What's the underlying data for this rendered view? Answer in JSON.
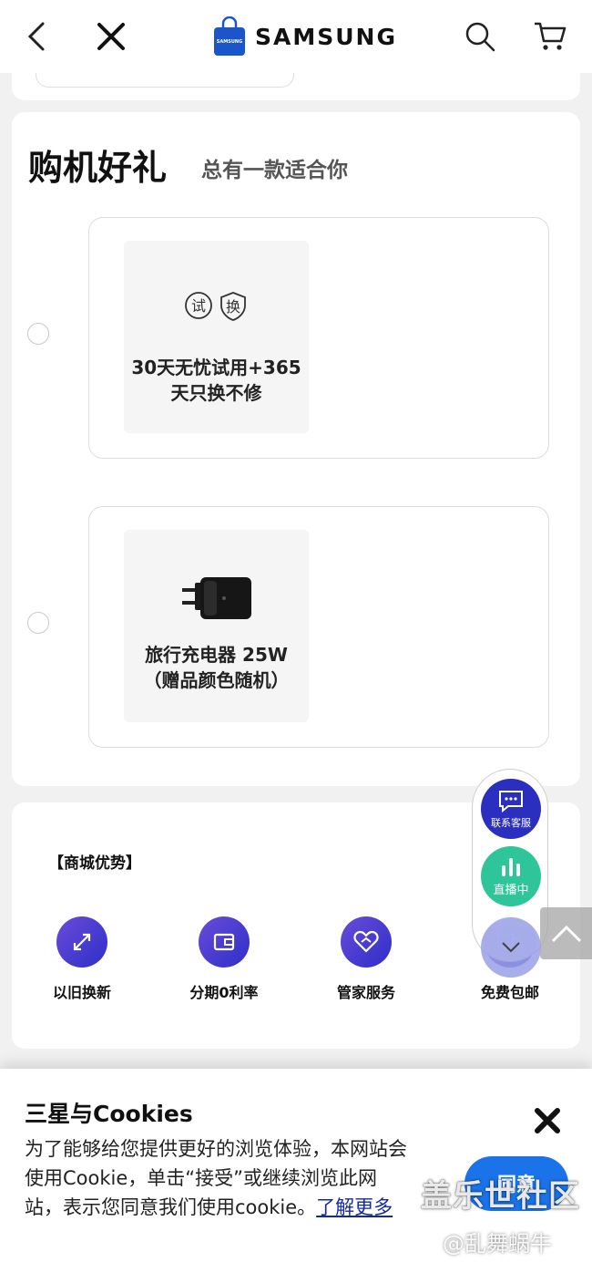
{
  "header": {
    "brand": "SAMSUNG",
    "bag_logo_text": "SAMSUNG"
  },
  "gifts": {
    "title": "购机好礼",
    "subtitle": "总有一款适合你",
    "options": [
      {
        "tag_left": "试",
        "tag_right": "换",
        "line1": "30天无忧试用+365",
        "line2": "天只换不修"
      },
      {
        "line1": "旅行充电器 25W",
        "line2": "（赠品颜色随机）"
      }
    ]
  },
  "advantages": {
    "title": "【商城优势】",
    "items": [
      {
        "label": "以旧换新",
        "icon": "trade-in-arrows-icon"
      },
      {
        "label": "分期0利率",
        "icon": "wallet-icon"
      },
      {
        "label": "管家服务",
        "icon": "heart-handshake-icon"
      },
      {
        "label": "免费包邮",
        "icon": "delivery-truck-icon"
      }
    ]
  },
  "float_widget": {
    "service_label": "联系客服",
    "live_label": "直播中"
  },
  "cookie": {
    "title": "三星与Cookies",
    "body": "为了能够给您提供更好的浏览体验，本网站会使用Cookie，单击“接受”或继续浏览此网站，表示您同意我们使用cookie。",
    "link": "了解更多",
    "agree": "同意"
  },
  "watermark": {
    "line1": "盖乐世社区",
    "line2": "@乱舞蜗牛"
  },
  "colors": {
    "brand_blue": "#1428a0",
    "agree_blue": "#1a73e8",
    "service_blue": "#2b2fbf",
    "live_green": "#2fc59a"
  }
}
